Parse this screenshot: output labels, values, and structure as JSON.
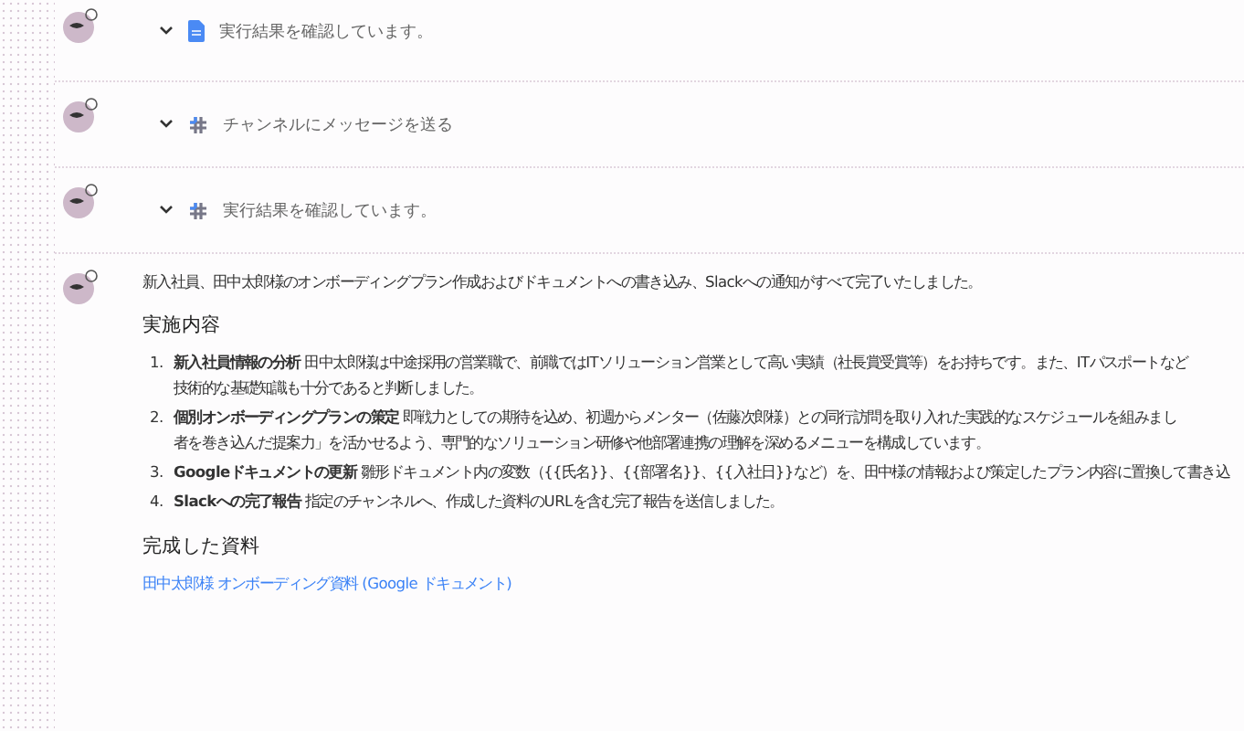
{
  "steps": [
    {
      "kind": "docs",
      "label": "実行結果を確認しています。",
      "expanded": true
    },
    {
      "kind": "slack",
      "label": "チャンネルにメッセージを送る",
      "expanded": true
    },
    {
      "kind": "slack",
      "label": "実行結果を確認しています。",
      "expanded": true
    }
  ],
  "message": {
    "intro": "新入社員、田中太郎様のオンボーディングプラン作成およびドキュメントへの書き込み、Slackへの通知がすべて完了いたしました。",
    "section_title": "実施内容",
    "items": [
      {
        "number": "1.",
        "title": "新入社員情報の分析",
        "lines": [
          "田中太郎様は中途採用の営業職で、前職ではITソリューション営業として高い実績（社長賞受賞等）をお持ちです。また、ITパスポートなど",
          "技術的な基礎知識も十分であると判断しました。"
        ]
      },
      {
        "number": "2.",
        "title": "個別オンボーディングプランの策定",
        "lines": [
          "即戦力としての期待を込め、初週からメンター（佐藤次郎様）との同行訪問を取り入れた実践的なスケジュールを組みまし",
          "者を巻き込んだ提案力」を活かせるよう、専門的なソリューション研修や他部署連携の理解を深めるメニューを構成しています。"
        ]
      },
      {
        "number": "3.",
        "title": "Googleドキュメントの更新",
        "lines": [
          "雛形ドキュメント内の変数（{{氏名}}、{{部署名}}、{{入社日}}など）を、田中様の情報および策定したプラン内容に置換して書き込"
        ]
      },
      {
        "number": "4.",
        "title": "Slackへの完了報告",
        "lines": [
          "指定のチャンネルへ、作成した資料のURLを含む完了報告を送信しました。"
        ]
      }
    ],
    "result_title": "完成した資料",
    "link": "田中太郎様 オンボーディング資料 (Google ドキュメント)"
  }
}
